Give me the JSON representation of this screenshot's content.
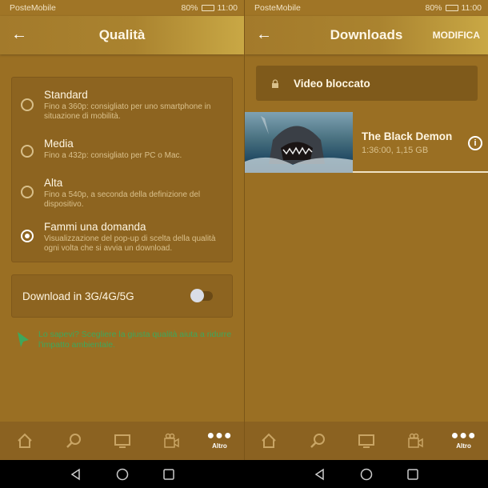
{
  "status_bar": {
    "carrier": "PosteMobile",
    "battery": "80%",
    "time": "11:00"
  },
  "quality_screen": {
    "title": "Qualità",
    "options": [
      {
        "label": "Standard",
        "description": "Fino a 360p: consigliato per uno smartphone in situazione di mobilità.",
        "selected": false
      },
      {
        "label": "Media",
        "description": "Fino a 432p: consigliato per PC o Mac.",
        "selected": false
      },
      {
        "label": "Alta",
        "description": "Fino a 540p, a seconda della definizione del dispositivo.",
        "selected": false
      },
      {
        "label": "Fammi una domanda",
        "description": "Visualizzazione del pop-up di scelta della qualità ogni volta che si avvia un download.",
        "selected": true
      }
    ],
    "mobile_download": {
      "label": "Download in 3G/4G/5G",
      "enabled": false
    },
    "tip": "Lo sapevi? Scegliere la giusta qualità aiuta a ridurre l'impatto ambientale."
  },
  "downloads_screen": {
    "title": "Downloads",
    "edit_label": "MODIFICA",
    "locked_label": "Video bloccato",
    "items": [
      {
        "title": "The Black Demon",
        "meta": "1:36:00, 1,15 GB"
      }
    ]
  },
  "bottom_nav": {
    "items": [
      "home-icon",
      "search-icon",
      "tv-icon",
      "camera-icon",
      "more-icon"
    ],
    "active_label": "Altro"
  },
  "colors": {
    "background": "#9a6f23",
    "card": "#8d6420",
    "tip": "#3ea75c"
  }
}
